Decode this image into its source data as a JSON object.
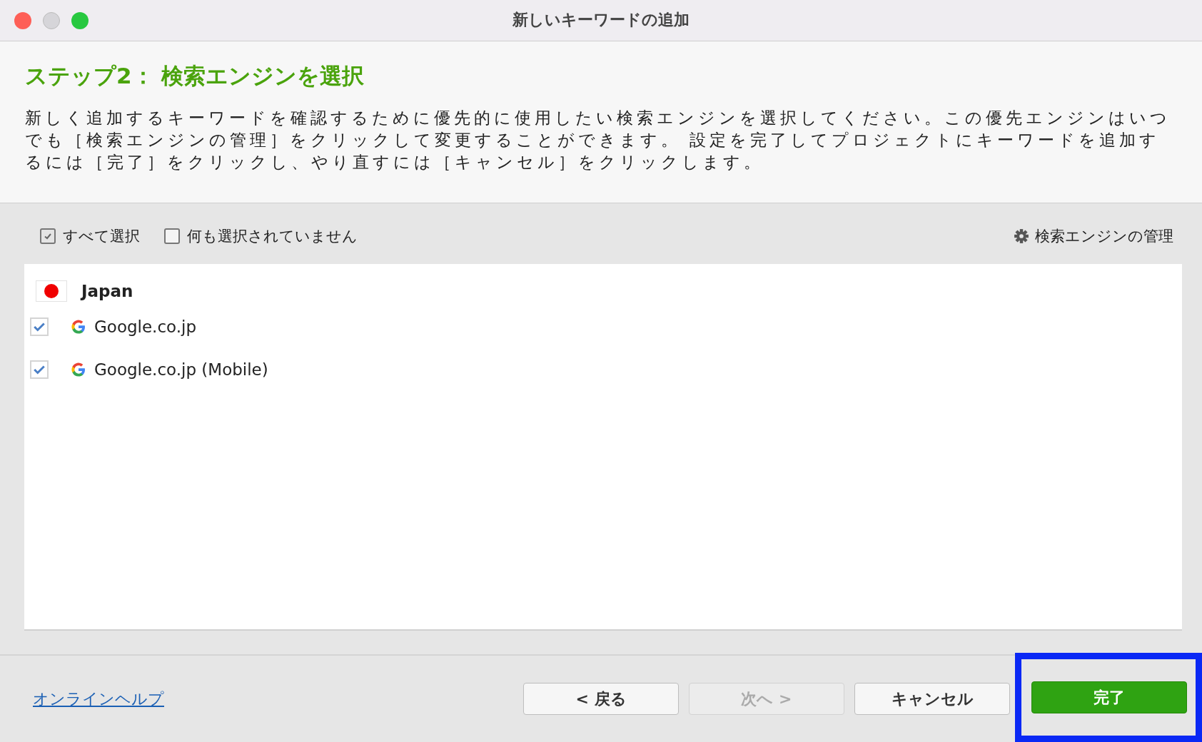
{
  "window": {
    "title": "新しいキーワードの追加"
  },
  "heading": "ステップ2： 検索エンジンを選択",
  "description": "新しく追加するキーワードを確認するために優先的に使用したい検索エンジンを選択してください。この優先エンジンはいつでも［検索エンジンの管理］をクリックして変更することができます。 設定を完了してプロジェクトにキーワードを追加するには［完了］をクリックし、やり直すには［キャンセル］をクリックします。",
  "toolbar": {
    "checks": [
      {
        "label": "すべて選択",
        "checked": true
      },
      {
        "label": "何も選択されていません",
        "checked": false
      }
    ],
    "manage": "検索エンジンの管理"
  },
  "groups": [
    {
      "name": "Japan",
      "engines": [
        {
          "name": "Google.co.jp",
          "checked": true
        },
        {
          "name": "Google.co.jp (Mobile)",
          "checked": true
        }
      ]
    }
  ],
  "footer": {
    "help_link": "オンラインヘルプ",
    "buttons": [
      {
        "label": "< 戻る",
        "kind": "normal",
        "highlighted": false
      },
      {
        "label": "次へ >",
        "kind": "disabled",
        "highlighted": false
      },
      {
        "label": "キャンセル",
        "kind": "normal",
        "highlighted": false
      },
      {
        "label": "完了",
        "kind": "primary",
        "highlighted": true
      }
    ]
  }
}
